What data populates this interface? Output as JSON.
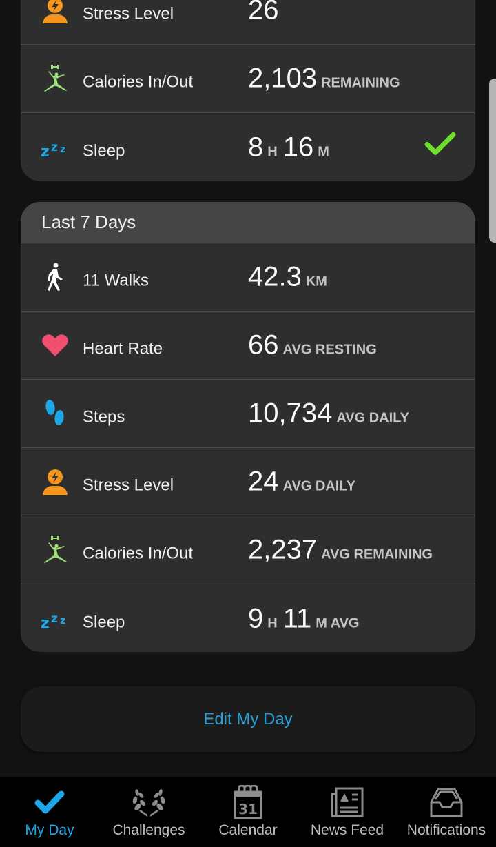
{
  "today_card": {
    "rows": [
      {
        "icon": "stress-icon",
        "label": "Stress Level",
        "value": "26",
        "unit": ""
      },
      {
        "icon": "calories-icon",
        "label": "Calories In/Out",
        "value": "2,103",
        "unit": "REMAINING"
      },
      {
        "icon": "sleep-icon",
        "label": "Sleep",
        "hours": "8",
        "hours_unit": "H",
        "minutes": "16",
        "minutes_unit": "M",
        "status": "goal-met-check-icon"
      }
    ]
  },
  "week_card": {
    "title": "Last 7 Days",
    "rows": [
      {
        "icon": "walk-icon",
        "label": "11 Walks",
        "value": "42.3",
        "unit": "KM"
      },
      {
        "icon": "heart-icon",
        "label": "Heart Rate",
        "value": "66",
        "unit": "AVG RESTING"
      },
      {
        "icon": "steps-icon",
        "label": "Steps",
        "value": "10,734",
        "unit": "AVG DAILY"
      },
      {
        "icon": "stress-icon",
        "label": "Stress Level",
        "value": "24",
        "unit": "AVG DAILY"
      },
      {
        "icon": "calories-icon",
        "label": "Calories In/Out",
        "value": "2,237",
        "unit": "AVG REMAINING"
      },
      {
        "icon": "sleep-icon",
        "label": "Sleep",
        "hours": "9",
        "hours_unit": "H",
        "minutes": "11",
        "minutes_unit": "M AVG"
      }
    ]
  },
  "edit_button": {
    "label": "Edit My Day"
  },
  "bottom_nav": {
    "items": [
      {
        "label": "My Day",
        "icon": "checkmark-icon",
        "active": true
      },
      {
        "label": "Challenges",
        "icon": "laurel-icon",
        "active": false
      },
      {
        "label": "Calendar",
        "icon": "calendar-icon",
        "calendar_day": "31",
        "active": false
      },
      {
        "label": "News Feed",
        "icon": "newspaper-icon",
        "active": false
      },
      {
        "label": "Notifications",
        "icon": "inbox-icon",
        "active": false
      }
    ]
  },
  "colors": {
    "accent_blue": "#1ea7e8",
    "stress_orange": "#f7961d",
    "calories_green": "#9be07a",
    "heart_pink": "#f0506e",
    "check_green": "#6ee22b"
  }
}
